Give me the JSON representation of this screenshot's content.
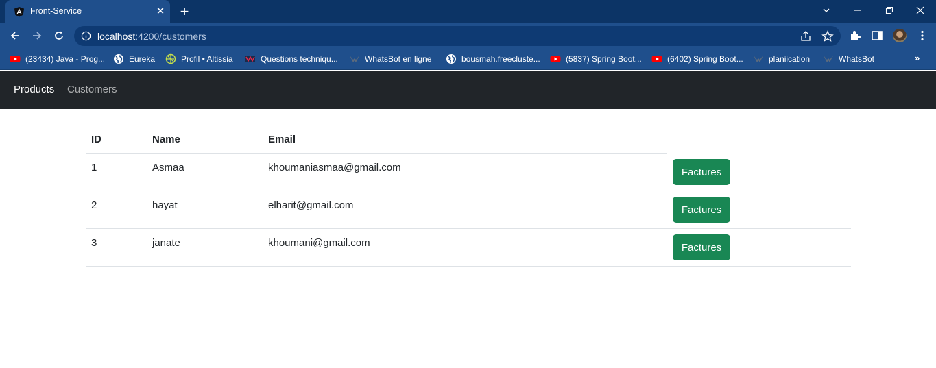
{
  "browser": {
    "tab_title": "Front-Service",
    "url_host": "localhost",
    "url_rest": ":4200/customers",
    "bookmarks": [
      {
        "label": "(23434) Java - Prog...",
        "icon": "youtube-icon"
      },
      {
        "label": "Eureka",
        "icon": "globe-icon"
      },
      {
        "label": "Profil • Altissia",
        "icon": "altissia-icon"
      },
      {
        "label": "Questions techniqu...",
        "icon": "site-icon"
      },
      {
        "label": "WhatsBot en ligne",
        "icon": "whatsbot-icon"
      },
      {
        "label": "bousmah.freecluste...",
        "icon": "globe-icon"
      },
      {
        "label": "(5837) Spring Boot...",
        "icon": "youtube-icon"
      },
      {
        "label": "(6402) Spring Boot...",
        "icon": "youtube-icon"
      },
      {
        "label": "planiication",
        "icon": "whatsbot-icon"
      },
      {
        "label": "WhatsBot",
        "icon": "whatsbot-icon"
      }
    ],
    "more_bookmarks": "»"
  },
  "navbar": {
    "products_label": "Products",
    "customers_label": "Customers"
  },
  "table": {
    "headers": [
      "ID",
      "Name",
      "Email"
    ],
    "rows": [
      {
        "id": "1",
        "name": "Asmaa",
        "email": "khoumaniasmaa@gmail.com",
        "action": "Factures"
      },
      {
        "id": "2",
        "name": "hayat",
        "email": "elharit@gmail.com",
        "action": "Factures"
      },
      {
        "id": "3",
        "name": "janate",
        "email": "khoumani@gmail.com",
        "action": "Factures"
      }
    ]
  },
  "colors": {
    "chrome_frame": "#0c3466",
    "chrome_toolbar": "#1f4f8c",
    "navbar_bg": "#212529",
    "button_success": "#198754"
  }
}
